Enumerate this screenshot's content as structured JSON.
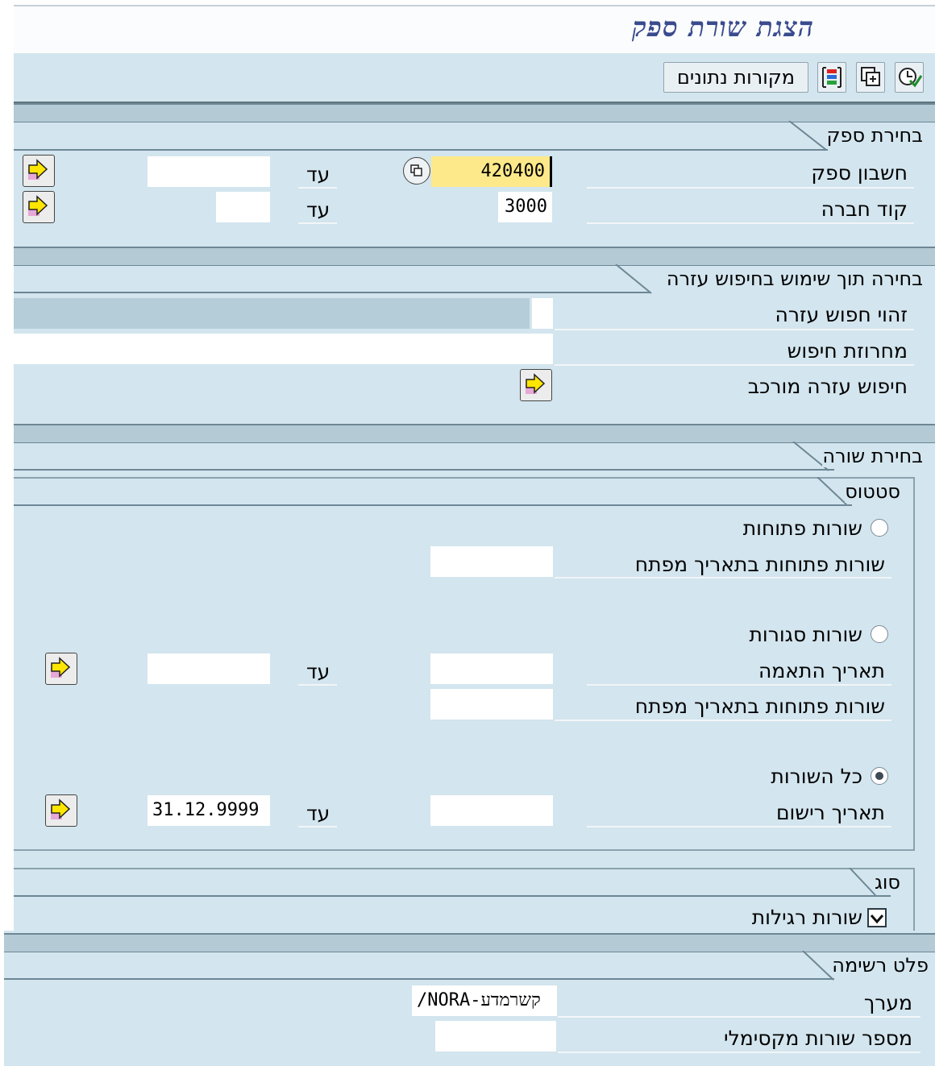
{
  "title": "הצגת שורת ספק",
  "toolbar": {
    "data_sources_label": "מקורות נתונים"
  },
  "vendor_selection": {
    "heading": "בחירת ספק",
    "vendor_account_label": "חשבון ספק",
    "vendor_account_value": "420400",
    "to_label": "עד",
    "company_code_label": "קוד חברה",
    "company_code_value": "3000"
  },
  "search_help": {
    "heading": "בחירה תוך שימוש בחיפוש עזרה",
    "search_help_id_label": "זהוי חפוש עזרה",
    "search_string_label": "מחרוזת חיפוש",
    "complex_search_label": "חיפוש עזרה מורכב"
  },
  "line_selection": {
    "heading": "בחירת שורה",
    "status_heading": "סטטוס",
    "open_items_label": "שורות פתוחות",
    "open_at_key_date_label": "שורות פתוחות בתאריך מפתח",
    "cleared_items_label": "שורות סגורות",
    "clearing_date_label": "תאריך התאמה",
    "to_label": "עד",
    "open_at_key_date_label2": "שורות פתוחות בתאריך מפתח",
    "all_items_label": "כל השורות",
    "posting_date_label": "תאריך רישום",
    "posting_date_to_value": "31.12.9999",
    "selected_status": "all_items"
  },
  "type": {
    "heading": "סוג",
    "normal_items_label": "שורות רגילות",
    "normal_items_checked": true
  },
  "list_output": {
    "heading": "פלט רשימה",
    "layout_label": "מערך",
    "layout_value": "/NORA-קשרמדע",
    "max_items_label": "מספר שורות מקסימלי"
  }
}
